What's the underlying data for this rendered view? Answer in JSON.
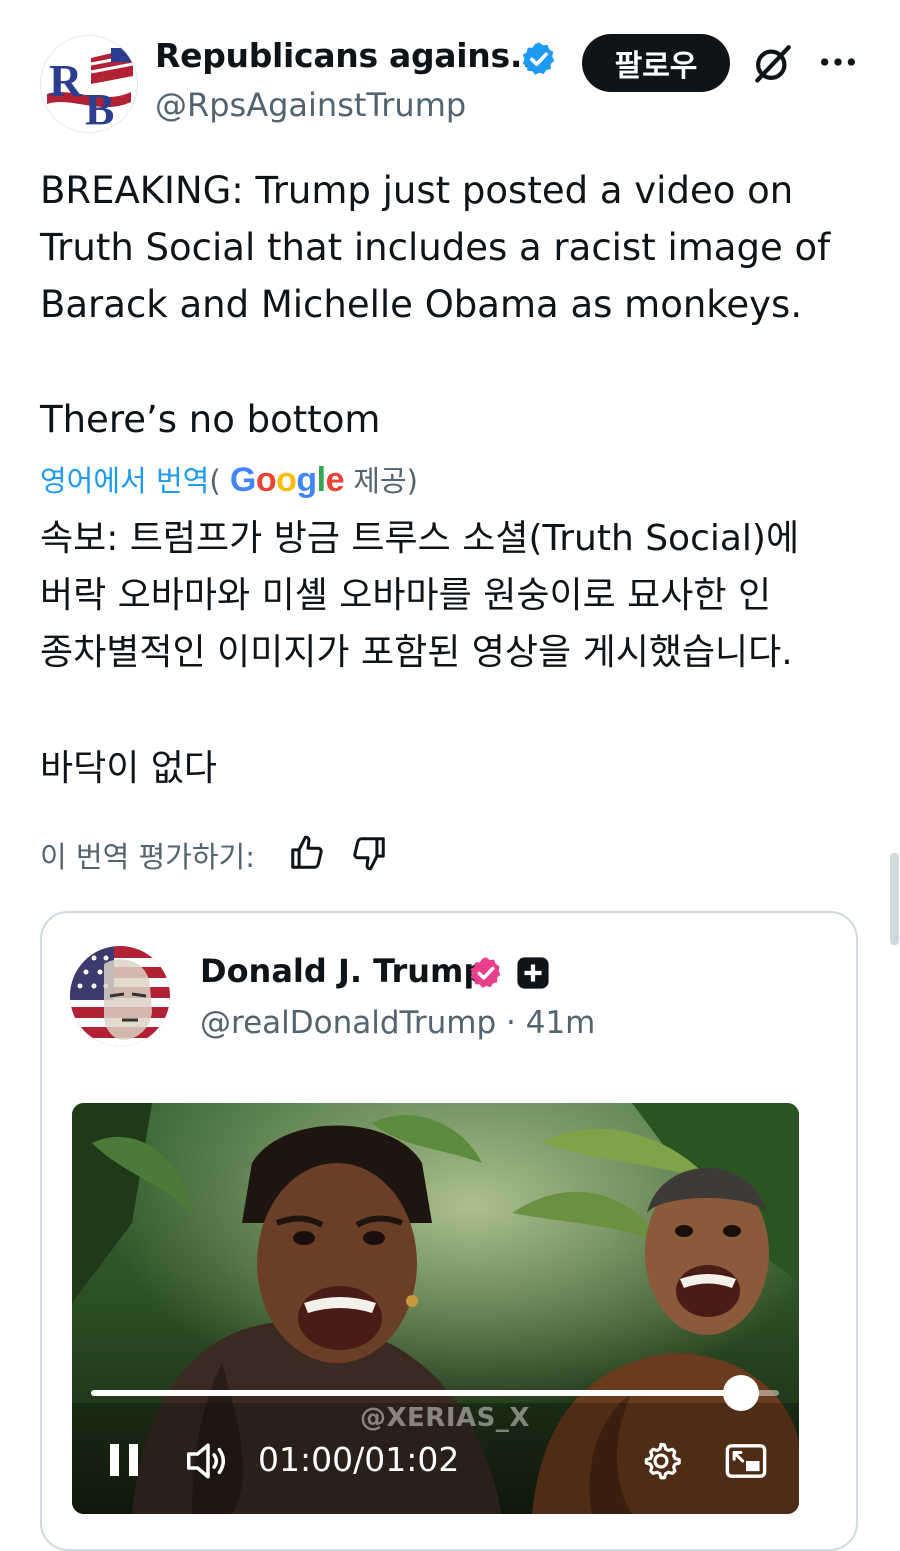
{
  "post": {
    "author_name": "Republicans agains...",
    "author_handle": "@RpsAgainstTrump",
    "avatar_initials": "RB",
    "follow_label": "팔로우",
    "text_lines": [
      "BREAKING: Trump just posted a video on",
      "Truth Social that includes a racist image of",
      "Barack and Michelle Obama as monkeys.",
      "There’s no bottom"
    ],
    "translation": {
      "attribution_prefix": "영어에서 번역",
      "attribution_open": "(",
      "google": [
        "G",
        "o",
        "o",
        "g",
        "l",
        "e"
      ],
      "attribution_suffix": " 제공)",
      "lines": [
        "속보: 트럼프가 방금 트루스 소셜(Truth Social)에",
        "버락 오바마와 미셸 오바마를 원숭이로 묘사한 인",
        "종차별적인 이미지가 포함된 영상을 게시했습니다.",
        "바닥이 없다"
      ],
      "rate_label": "이 번역 평가하기:"
    }
  },
  "embed": {
    "author_name": "Donald J. Trump",
    "author_handle": "@realDonaldTrump",
    "separator": " · ",
    "time_ago": "41m",
    "video": {
      "watermark": "@XERIAS_X",
      "time_display": "01:00/01:02",
      "progress": 0.945
    }
  },
  "colors": {
    "verified_blue": "#1d9bf0",
    "embed_badge_pink": "#e83e8c",
    "text_primary": "#0f1419",
    "text_secondary": "#536471"
  },
  "icons": {
    "verified": "verified-badge-icon",
    "grok": "grok-icon",
    "more": "more-icon",
    "thumbs_up": "thumbs-up-icon",
    "thumbs_down": "thumbs-down-icon",
    "pause": "pause-icon",
    "volume": "volume-icon",
    "settings": "settings-icon",
    "pip": "picture-in-picture-icon"
  }
}
